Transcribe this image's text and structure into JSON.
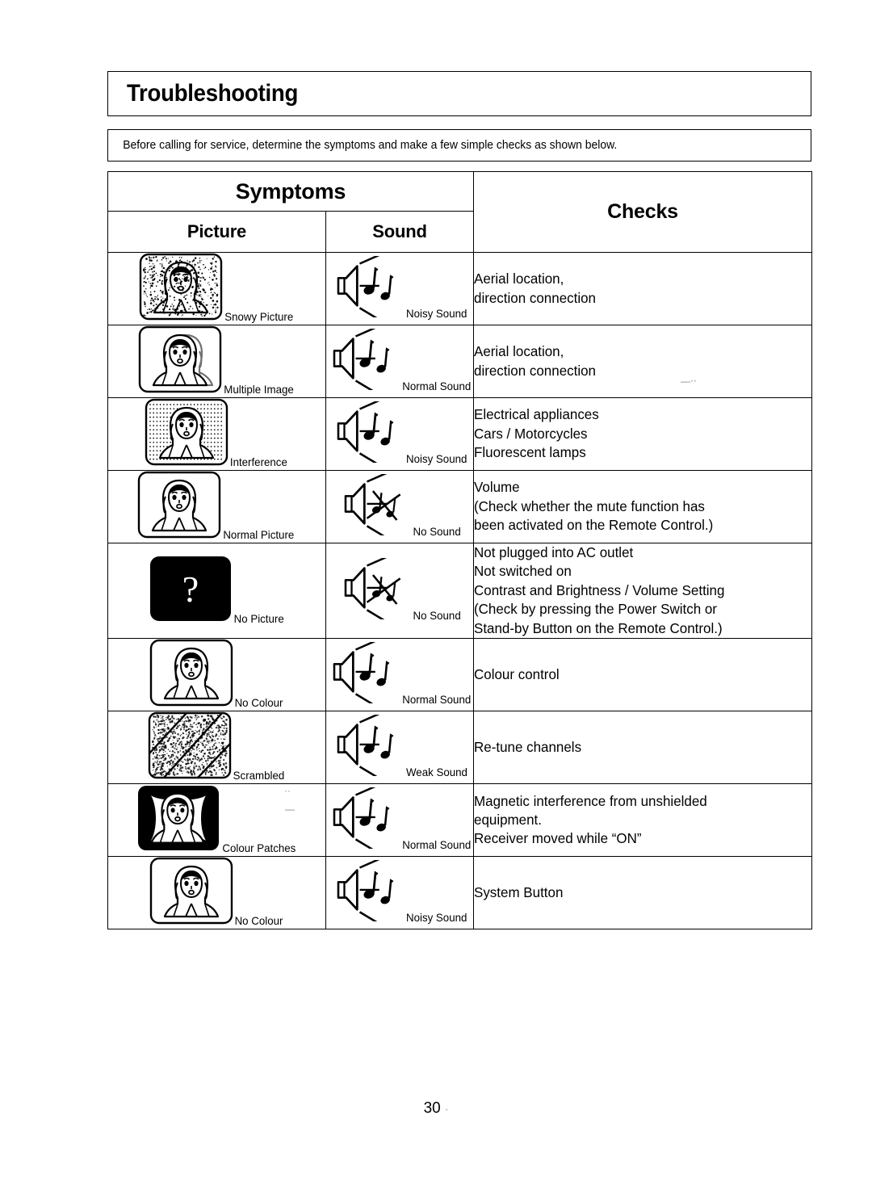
{
  "document": {
    "title": "Troubleshooting",
    "intro": "Before calling for service, determine the symptoms and make a few simple checks as shown below.",
    "page_number": "30"
  },
  "table": {
    "header_group": "Symptoms",
    "header_picture": "Picture",
    "header_sound": "Sound",
    "header_checks": "Checks",
    "rows": [
      {
        "picture_icon": "snowy-picture-icon",
        "picture_label": "Snowy Picture",
        "sound_icon": "noisy-sound-icon",
        "sound_label": "Noisy Sound",
        "checks": [
          "Aerial location,",
          "direction connection"
        ]
      },
      {
        "picture_icon": "multiple-image-icon",
        "picture_label": "Multiple Image",
        "sound_icon": "normal-sound-icon",
        "sound_label": "Normal Sound",
        "checks": [
          "Aerial location,",
          "direction connection"
        ]
      },
      {
        "picture_icon": "interference-icon",
        "picture_label": "Interference",
        "sound_icon": "noisy-sound-icon",
        "sound_label": "Noisy Sound",
        "checks": [
          "Electrical appliances",
          "Cars / Motorcycles",
          "Fluorescent lamps"
        ]
      },
      {
        "picture_icon": "normal-picture-icon",
        "picture_label": "Normal Picture",
        "sound_icon": "no-sound-icon",
        "sound_label": "No Sound",
        "checks": [
          "Volume",
          "(Check whether the mute function has",
          "been activated on the Remote Control.)"
        ]
      },
      {
        "picture_icon": "no-picture-icon",
        "picture_label": "No Picture",
        "sound_icon": "no-sound-icon",
        "sound_label": "No Sound",
        "checks": [
          "Not plugged into AC outlet",
          "Not switched on",
          "Contrast and Brightness / Volume Setting",
          "(Check by pressing the Power Switch or",
          "Stand-by Button on the Remote Control.)"
        ]
      },
      {
        "picture_icon": "no-colour-icon",
        "picture_label": "No Colour",
        "sound_icon": "normal-sound-icon",
        "sound_label": "Normal Sound",
        "checks": [
          "Colour control"
        ]
      },
      {
        "picture_icon": "scrambled-icon",
        "picture_label": "Scrambled",
        "sound_icon": "weak-sound-icon",
        "sound_label": "Weak Sound",
        "checks": [
          "Re-tune channels"
        ]
      },
      {
        "picture_icon": "colour-patches-icon",
        "picture_label": "Colour Patches",
        "sound_icon": "normal-sound-icon",
        "sound_label": "Normal Sound",
        "checks": [
          "Magnetic interference from unshielded",
          "equipment.",
          "Receiver moved while “ON”"
        ]
      },
      {
        "picture_icon": "no-colour-icon",
        "picture_label": "No Colour",
        "sound_icon": "noisy-sound-icon",
        "sound_label": "Noisy Sound",
        "checks": [
          "System Button"
        ]
      }
    ]
  },
  "colors": {
    "ink": "#000000",
    "paper": "#ffffff"
  }
}
